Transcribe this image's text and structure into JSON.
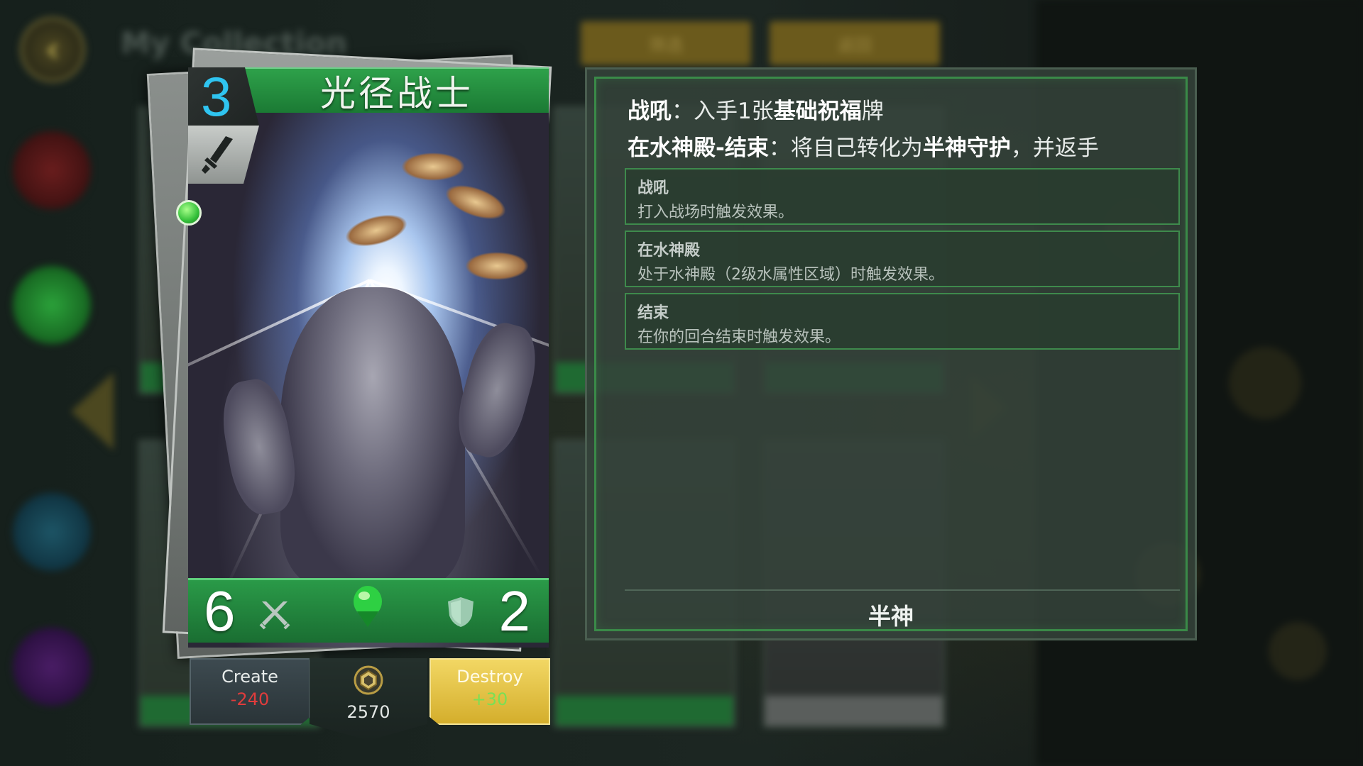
{
  "background": {
    "title": "My Collection",
    "tab_left": "筛选",
    "tab_right": "返回"
  },
  "card": {
    "cost": "3",
    "name": "光径战士",
    "attack": "6",
    "health": "2",
    "type_icon": "sword-icon",
    "rarity_icon": "green-gem-icon"
  },
  "craft": {
    "create_label": "Create",
    "create_cost": "-240",
    "dust_total": "2570",
    "destroy_label": "Destroy",
    "destroy_gain": "+30"
  },
  "description": {
    "line1": {
      "kw": "战吼",
      "sep": "：",
      "pre": "入手1张",
      "bold": "基础祝福",
      "post": "牌"
    },
    "line2": {
      "kw": "在水神殿-结束",
      "sep": "：",
      "pre": "将自己转化为",
      "bold": "半神守护",
      "post": "，并返手"
    },
    "keywords": [
      {
        "title": "战吼",
        "text": "打入战场时触发效果。"
      },
      {
        "title": "在水神殿",
        "text": "处于水神殿（2级水属性区域）时触发效果。"
      },
      {
        "title": "结束",
        "text": "在你的回合结束时触发效果。"
      }
    ],
    "tribe": "半神"
  },
  "colors": {
    "cost": "#2fc4f0",
    "banner": "#1f8a3a",
    "create_cost": "#e03c3c",
    "destroy_gain": "#7adf55",
    "destroy_button": "#e6c445"
  }
}
